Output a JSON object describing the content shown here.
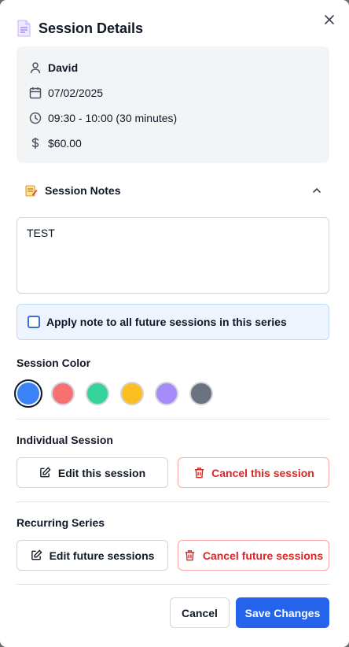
{
  "modal": {
    "title": "Session Details",
    "close_icon": "close-icon",
    "title_icon": "document-icon"
  },
  "info": {
    "client_name": "David",
    "date": "07/02/2025",
    "time": "09:30 - 10:00 (30 minutes)",
    "price": "$60.00",
    "icons": [
      "user-icon",
      "calendar-icon",
      "clock-icon",
      "dollar-icon"
    ]
  },
  "notes": {
    "label": "Session Notes",
    "value": "TEST",
    "icon": "memo-icon",
    "expanded": true
  },
  "apply": {
    "label": "Apply note to all future sessions in this series",
    "checked": false
  },
  "color": {
    "label": "Session Color",
    "options": [
      "#3b82f6",
      "#f87171",
      "#34d399",
      "#fbbf24",
      "#a78bfa",
      "#6b7280"
    ],
    "selected": "#3b82f6"
  },
  "individual": {
    "label": "Individual Session",
    "edit_label": "Edit this session",
    "cancel_label": "Cancel this session"
  },
  "recurring": {
    "label": "Recurring Series",
    "edit_label": "Edit future sessions",
    "cancel_label": "Cancel future sessions"
  },
  "footer": {
    "cancel_label": "Cancel",
    "save_label": "Save Changes"
  },
  "colors": {
    "primary": "#2563eb",
    "danger": "#dc2626",
    "info_bg": "#f3f4f6",
    "apply_bg": "#eef4fd"
  }
}
